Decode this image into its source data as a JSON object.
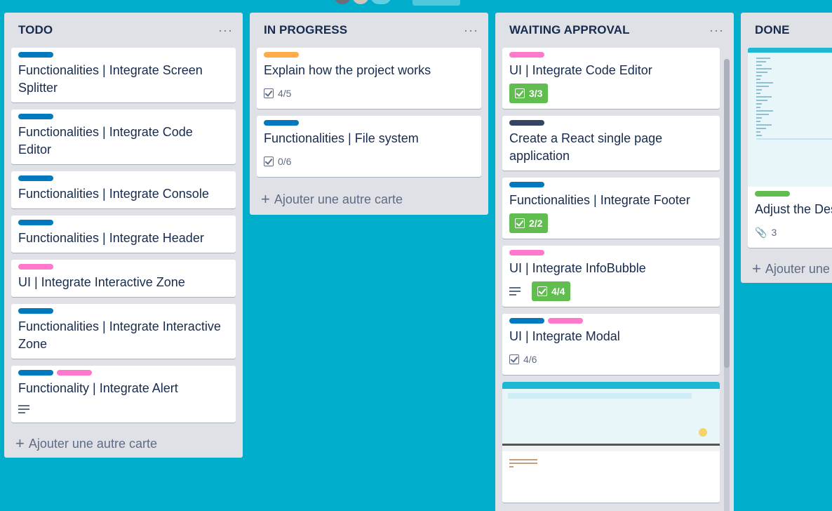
{
  "colors": {
    "background": "#00aecc",
    "label_blue": "#0079bf",
    "label_pink": "#ff78cb",
    "label_orange": "#ffab4a",
    "label_dark": "#344563",
    "label_green": "#61bd4f",
    "checklist_done": "#61bd4f"
  },
  "lists": [
    {
      "title": "TODO",
      "menu": "···",
      "add_card": "Ajouter une autre carte",
      "cards": [
        {
          "labels": [
            "blue"
          ],
          "title": "Functionalities | Integrate Screen Splitter"
        },
        {
          "labels": [
            "blue"
          ],
          "title": "Functionalities | Integrate Code Editor"
        },
        {
          "labels": [
            "blue"
          ],
          "title": "Functionalities | Integrate Console"
        },
        {
          "labels": [
            "blue"
          ],
          "title": "Functionalities | Integrate Header"
        },
        {
          "labels": [
            "pink"
          ],
          "title": "UI | Integrate Interactive Zone"
        },
        {
          "labels": [
            "blue"
          ],
          "title": "Functionalities | Integrate Interactive Zone"
        },
        {
          "labels": [
            "blue",
            "pink"
          ],
          "title": "Functionality | Integrate Alert",
          "has_description": true
        }
      ]
    },
    {
      "title": "IN PROGRESS",
      "menu": "···",
      "add_card": "Ajouter une autre carte",
      "cards": [
        {
          "labels": [
            "orange"
          ],
          "title": "Explain how the project works",
          "checklist": "4/5",
          "complete": false
        },
        {
          "labels": [
            "blue"
          ],
          "title": "Functionalities | File system",
          "checklist": "0/6",
          "complete": false
        }
      ]
    },
    {
      "title": "WAITING APPROVAL",
      "menu": "···",
      "cards": [
        {
          "labels": [
            "pink"
          ],
          "title": "UI | Integrate Code Editor",
          "checklist": "3/3",
          "complete": true
        },
        {
          "labels": [
            "dark"
          ],
          "title": "Create a React single page application"
        },
        {
          "labels": [
            "blue"
          ],
          "title": "Functionalities | Integrate Footer",
          "checklist": "2/2",
          "complete": true
        },
        {
          "labels": [
            "pink"
          ],
          "title": "UI | Integrate InfoBubble",
          "checklist": "4/4",
          "complete": true,
          "has_description": true
        },
        {
          "labels": [
            "blue",
            "pink"
          ],
          "title": "UI | Integrate Modal",
          "checklist": "4/6",
          "complete": false
        }
      ]
    },
    {
      "title": "DONE",
      "add_card": "Ajouter une",
      "cards": [
        {
          "labels": [
            "green"
          ],
          "title": "Adjust the Des",
          "attachments": "3"
        }
      ]
    }
  ]
}
